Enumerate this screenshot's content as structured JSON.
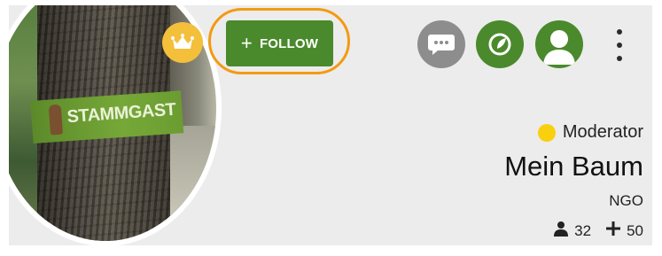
{
  "profile": {
    "banner_text": "STAMMGAST",
    "follow_label": "FOLLOW",
    "role": "Moderator",
    "name": "Mein Baum",
    "org_type": "NGO",
    "followers_count": "32",
    "following_count": "50"
  },
  "colors": {
    "panel_bg": "#ececec",
    "follow_green": "#4a8a2c",
    "highlight_orange": "#f39a12",
    "crown_gold": "#f4bf3a",
    "chat_gray": "#8d8d8d",
    "moderator_yellow": "#f8d00f"
  },
  "icons": {
    "crown": "crown-icon",
    "chat": "chat-bubble-icon",
    "green_action": "leaf-circle-icon",
    "profile": "user-icon",
    "more": "more-vertical-icon",
    "person": "person-icon",
    "plus": "plus-icon"
  }
}
